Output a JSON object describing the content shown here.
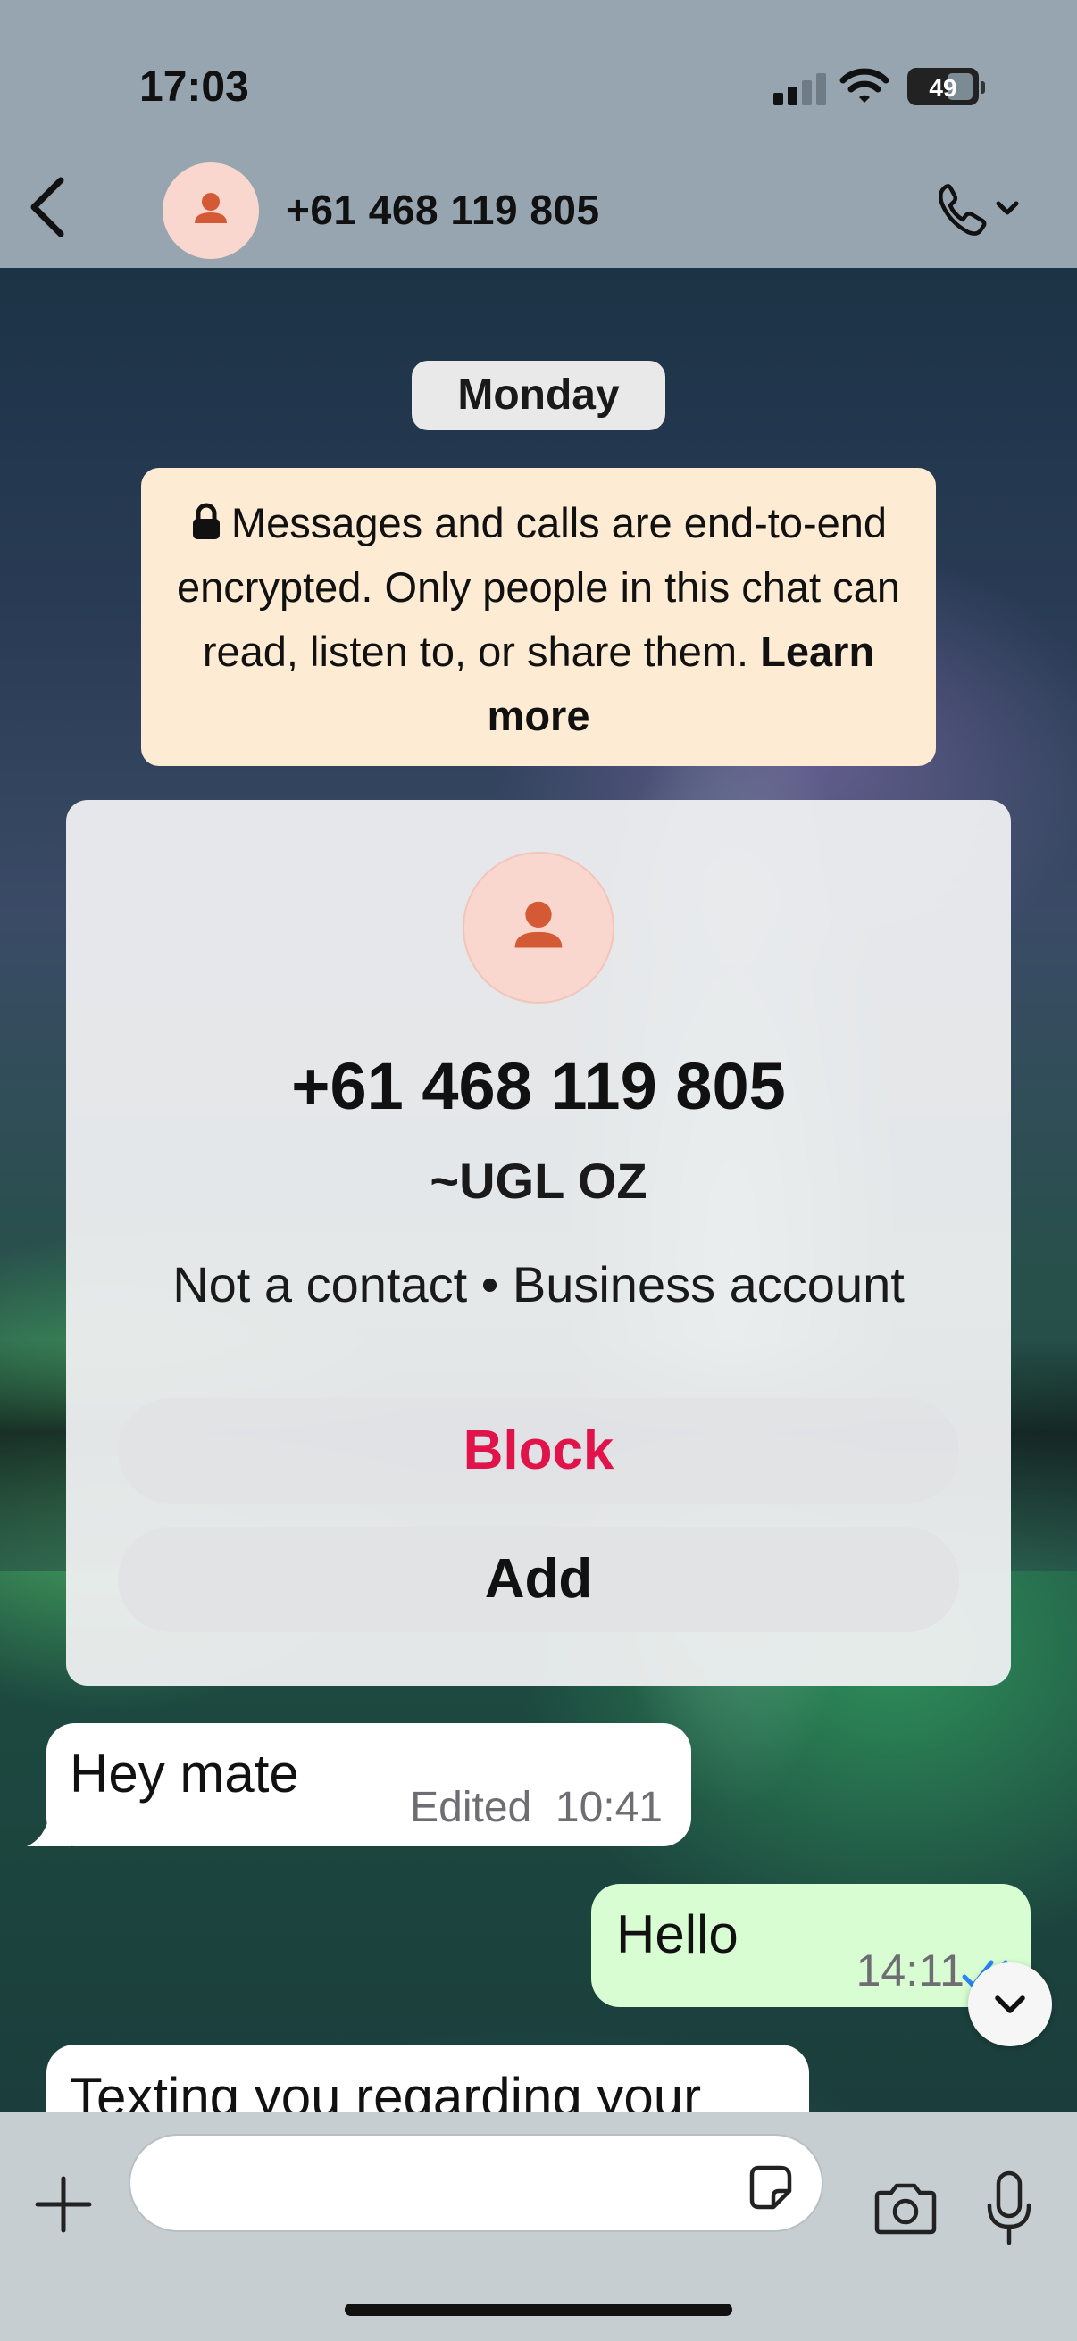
{
  "status_bar": {
    "time": "17:03",
    "battery": "49"
  },
  "header": {
    "contact": "+61 468 119 805",
    "icons": [
      "back-icon",
      "avatar-icon",
      "phone-icon",
      "chevron-down-icon"
    ]
  },
  "chat": {
    "date_chip": "Monday",
    "encryption_notice": {
      "text": "Messages and calls are end-to-end encrypted. Only people in this chat can read, listen to, or share them.",
      "link": "Learn more"
    },
    "contact_card": {
      "number": "+61 468 119 805",
      "name": "~UGL OZ",
      "status": "Not a contact • Business account",
      "block_label": "Block",
      "add_label": "Add"
    },
    "messages": [
      {
        "direction": "incoming",
        "text": "Hey mate",
        "meta": "Edited  10:41"
      },
      {
        "direction": "outgoing",
        "text": "Hello",
        "time": "14:11",
        "status": "read"
      },
      {
        "direction": "incoming",
        "text": "Texting you regarding your"
      }
    ]
  },
  "composer": {
    "placeholder": "",
    "icons": [
      "plus-icon",
      "sticker-icon",
      "camera-icon",
      "mic-icon"
    ]
  },
  "colors": {
    "block": "#e0134a",
    "outgoing_bubble": "#d8fdd2",
    "read_ticks": "#2a86f0",
    "notice": "#fdecd3",
    "avatar_fg": "#d35a35",
    "avatar_bg": "#fad7ce"
  }
}
